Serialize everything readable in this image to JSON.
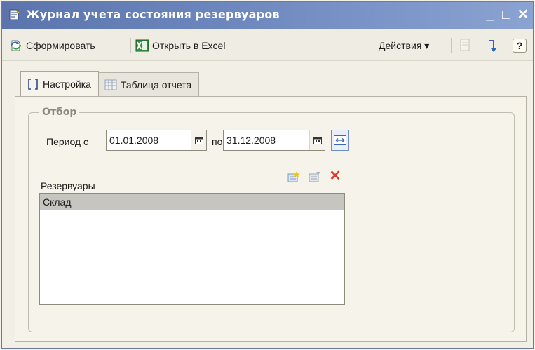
{
  "window": {
    "title": "Журнал учета состояния резервуаров",
    "minimize": "_",
    "maximize": "□",
    "close": "✕"
  },
  "toolbar": {
    "generate_label": "Сформировать",
    "excel_label": "Открыть в Excel",
    "actions_label": "Действия ▾",
    "help_label": "?"
  },
  "tabs": [
    {
      "label": "Настройка",
      "active": true
    },
    {
      "label": "Таблица отчета",
      "active": false
    }
  ],
  "filter": {
    "legend": "Отбор",
    "period_label": "Период с",
    "date_from": "01.01.2008",
    "to_label": "по",
    "date_to": "31.12.2008"
  },
  "reservoirs": {
    "label": "Резервуары",
    "items": [
      "Склад"
    ]
  },
  "colors": {
    "title_bar": "#5b74ad",
    "excel_green": "#2f8a3a",
    "delete_red": "#e03a2a",
    "selected_row": "#c6c5c0"
  }
}
